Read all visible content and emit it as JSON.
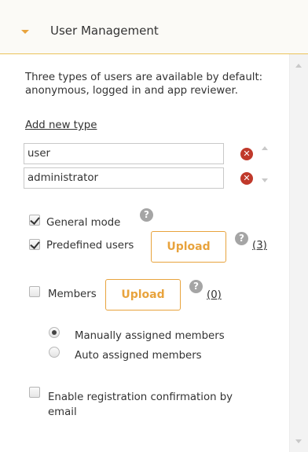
{
  "header": {
    "title": "User Management"
  },
  "description": "Three types of users are available by default: anonymous, logged in and app reviewer.",
  "add_type_link": "Add new type",
  "user_types": [
    {
      "value": "user"
    },
    {
      "value": "administrator"
    }
  ],
  "remove_glyph": "✕",
  "help_glyph": "?",
  "options": {
    "general_mode": {
      "label": "General mode",
      "checked": true
    },
    "predefined_users": {
      "label": "Predefined users",
      "checked": true,
      "upload_label": "Upload",
      "count": "(3)"
    },
    "members": {
      "label": "Members",
      "checked": false,
      "upload_label": "Upload",
      "count": "(0)"
    },
    "assignment": {
      "manual": {
        "label": "Manually assigned members",
        "selected": true
      },
      "auto": {
        "label": "Auto assigned members",
        "selected": false
      }
    },
    "registration_confirmation": {
      "label": "Enable registration confirmation by email",
      "checked": false
    }
  },
  "colors": {
    "accent": "#e8a33d",
    "header_border": "#ebc35a",
    "remove": "#c0392b",
    "help": "#a5a5a5"
  },
  "icons": {
    "collapse": "caret-down-icon",
    "remove": "remove-circle-icon",
    "help": "help-circle-icon"
  }
}
